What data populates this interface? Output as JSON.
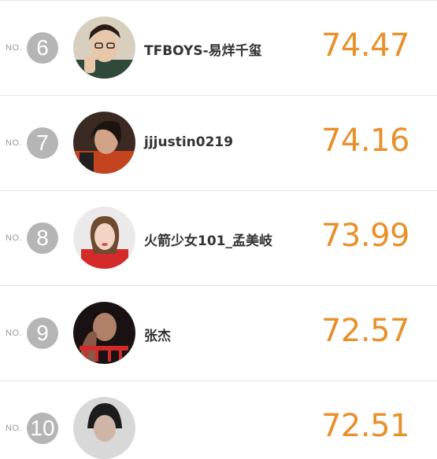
{
  "ranking": {
    "items": [
      {
        "no_label": "NO.",
        "rank": "6",
        "name": "TFBOYS-易烊千玺",
        "score": "74.47"
      },
      {
        "no_label": "NO.",
        "rank": "7",
        "name": "jjjustin0219",
        "score": "74.16"
      },
      {
        "no_label": "NO.",
        "rank": "8",
        "name": "火箭少女101_孟美岐",
        "score": "73.99"
      },
      {
        "no_label": "NO.",
        "rank": "9",
        "name": "张杰",
        "score": "72.57"
      },
      {
        "no_label": "NO.",
        "rank": "10",
        "name": "",
        "score": "72.51"
      }
    ]
  },
  "colors": {
    "score": "#e8902a",
    "rank_badge": "#b5b5b5",
    "divider": "#e6e6e6"
  }
}
